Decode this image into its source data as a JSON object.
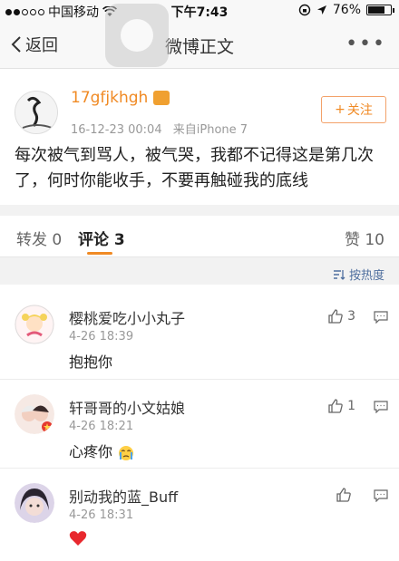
{
  "status_bar": {
    "carrier": "中国移动",
    "time": "下午7:43",
    "battery": "76%",
    "battery_level": 0.76
  },
  "nav": {
    "back_label": "返回",
    "title": "微博正文",
    "more_label": "•••"
  },
  "post": {
    "author": "17gfjkhgh",
    "timestamp": "16-12-23 00:04",
    "source": "来自iPhone 7",
    "follow_label": "关注",
    "text": "每次被气到骂人，被气哭，我都不记得这是第几次了，何时你能收手，不要再触碰我的底线"
  },
  "tabs": {
    "repost": "转发 0",
    "comments": "评论 3",
    "likes": "赞 10",
    "sort_label": "按热度"
  },
  "comments": [
    {
      "name": "樱桃爱吃小小丸子",
      "time": "4-26 18:39",
      "text": "抱抱你",
      "likes": "3"
    },
    {
      "name": "轩哥哥的小文姑娘",
      "time": "4-26 18:21",
      "text": "心疼你",
      "likes": "1"
    },
    {
      "name": "别动我的蓝_Buff",
      "time": "4-26 18:31",
      "text": "",
      "likes": ""
    }
  ],
  "colors": {
    "accent": "#f08a24",
    "link": "#4e6e9e"
  }
}
